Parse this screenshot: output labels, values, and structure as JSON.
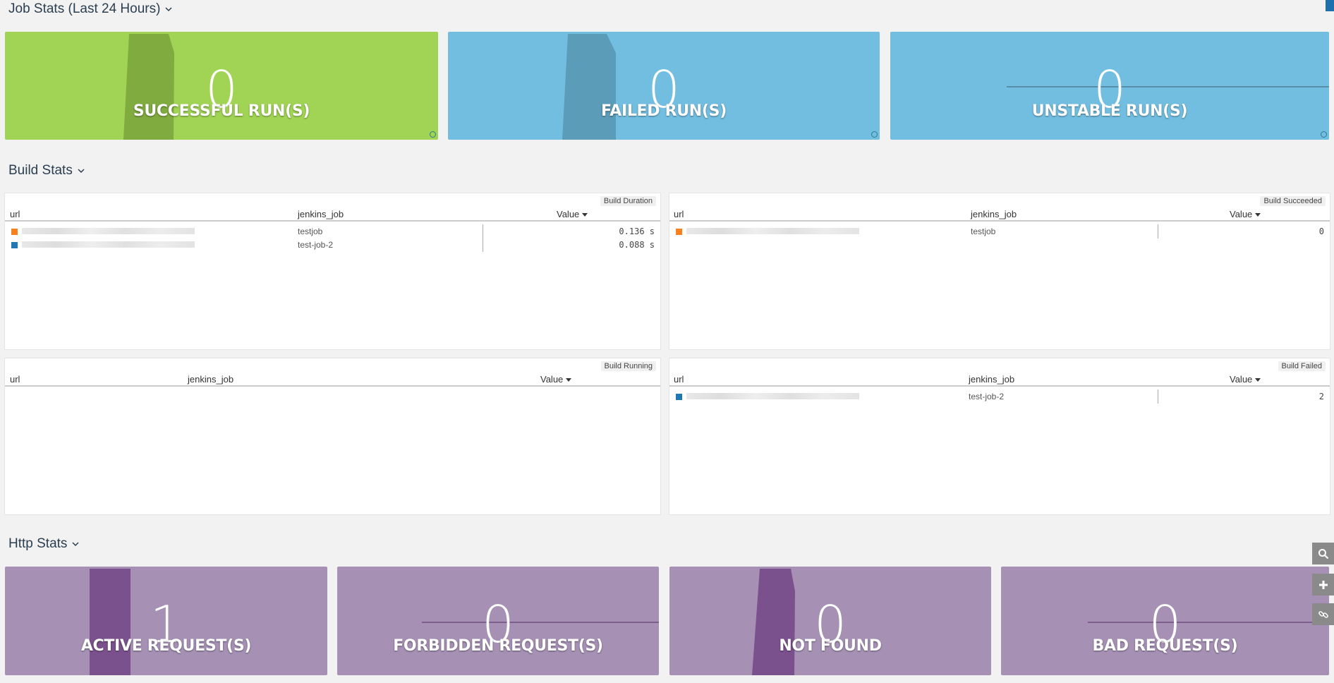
{
  "sections": {
    "job_stats": "Job Stats (Last 24 Hours)",
    "build_stats": "Build Stats",
    "http_stats": "Http Stats"
  },
  "job_cards": [
    {
      "value": "0",
      "label": "SUCCESSFUL RUN(S)",
      "bg": "#a1d454",
      "accent": "#80ab3f"
    },
    {
      "value": "0",
      "label": "FAILED RUN(S)",
      "bg": "#72bee1",
      "accent": "#5b9cb9"
    },
    {
      "value": "0",
      "label": "UNSTABLE RUN(S)",
      "bg": "#72bee1",
      "accent": "#4f7f98"
    }
  ],
  "http_cards": [
    {
      "value": "1",
      "label": "ACTIVE REQUEST(S)",
      "bg": "#a691b5",
      "accent": "#7a518c"
    },
    {
      "value": "0",
      "label": "FORBIDDEN REQUEST(S)",
      "bg": "#a691b5",
      "accent": "#6f4f80"
    },
    {
      "value": "0",
      "label": "NOT FOUND",
      "bg": "#a691b5",
      "accent": "#7a518c"
    },
    {
      "value": "0",
      "label": "BAD REQUEST(S)",
      "bg": "#a691b5",
      "accent": "#6f4f80"
    }
  ],
  "panels": {
    "build_duration": {
      "title": "Build Duration",
      "columns": [
        "url",
        "jenkins_job",
        "Value"
      ],
      "rows": [
        {
          "swatch": "#f5821f",
          "job": "testjob",
          "value": "0.136  s"
        },
        {
          "swatch": "#1f77b4",
          "job": "test-job-2",
          "value": "0.088  s"
        }
      ]
    },
    "build_succeeded": {
      "title": "Build Succeeded",
      "columns": [
        "url",
        "jenkins_job",
        "Value"
      ],
      "rows": [
        {
          "swatch": "#f5821f",
          "job": "testjob",
          "value": "0"
        }
      ]
    },
    "build_running": {
      "title": "Build Running",
      "columns": [
        "url",
        "jenkins_job",
        "Value"
      ],
      "rows": []
    },
    "build_failed": {
      "title": "Build Failed",
      "columns": [
        "url",
        "jenkins_job",
        "Value"
      ],
      "rows": [
        {
          "swatch": "#1f77b4",
          "job": "test-job-2",
          "value": "2"
        }
      ]
    }
  },
  "tools": [
    "search-icon",
    "plus-icon",
    "link-icon"
  ]
}
